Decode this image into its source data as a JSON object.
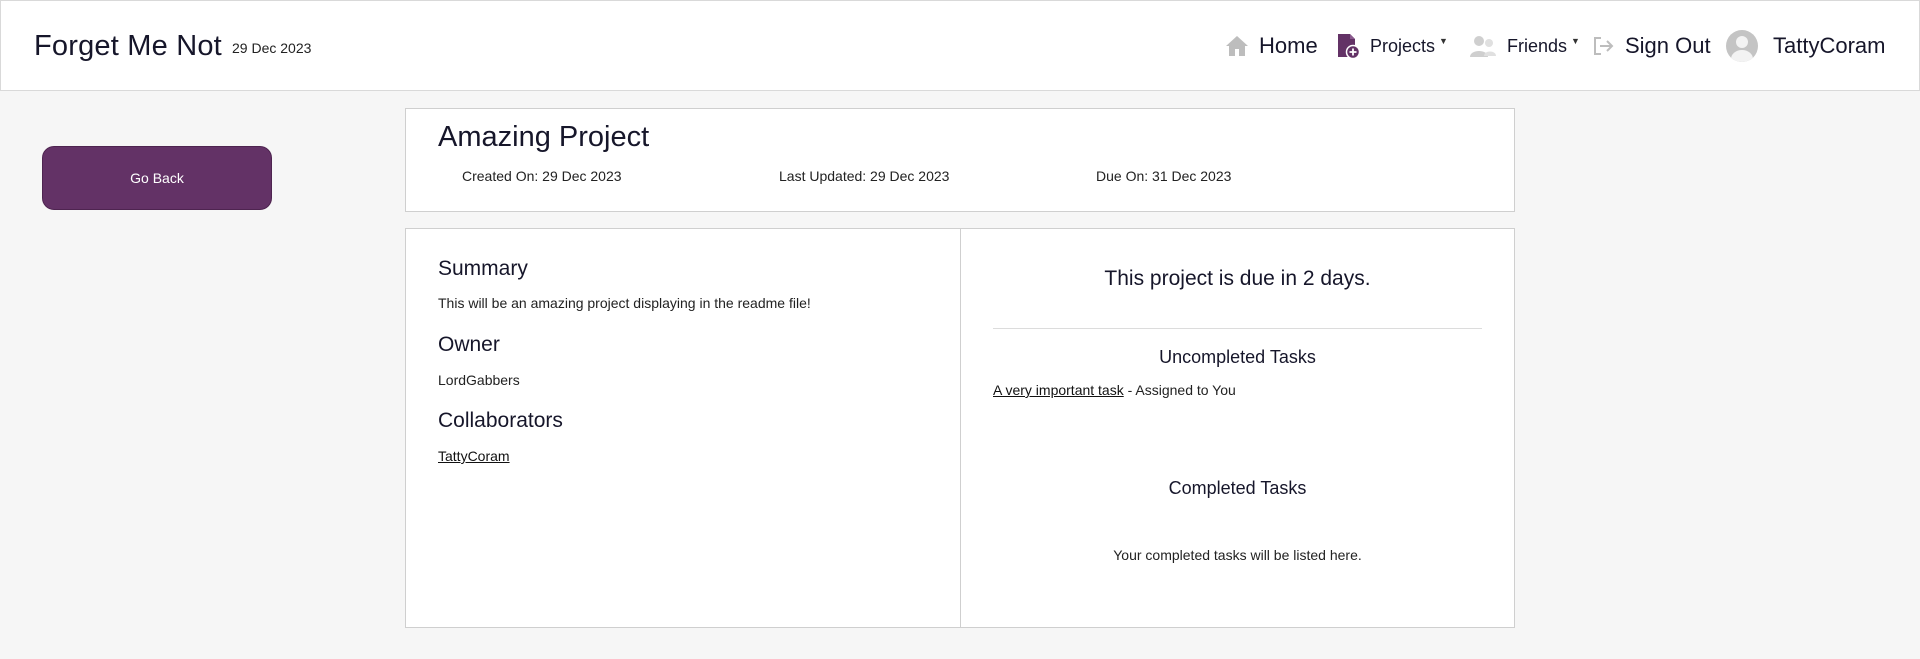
{
  "nav": {
    "brand": "Forget Me Not",
    "date": "29 Dec 2023",
    "home_label": "Home",
    "projects_label": "Projects",
    "friends_label": "Friends",
    "signout_label": "Sign Out",
    "username": "TattyCoram",
    "accent_color": "#633266"
  },
  "sidebar": {
    "go_back_label": "Go Back"
  },
  "project": {
    "title": "Amazing Project",
    "created_on": "Created On: 29 Dec 2023",
    "last_updated": "Last Updated: 29 Dec 2023",
    "due_on": "Due On: 31 Dec 2023"
  },
  "details": {
    "summary_heading": "Summary",
    "summary_text": "This will be an amazing project displaying in the readme file!",
    "owner_heading": "Owner",
    "owner_name": "LordGabbers",
    "collaborators_heading": "Collaborators",
    "collaborators": [
      "TattyCoram"
    ]
  },
  "tasks": {
    "due_message": "This project is due in 2 days.",
    "uncompleted_heading": "Uncompleted Tasks",
    "uncompleted": [
      {
        "name": "A very important task",
        "assigned": " - Assigned to You"
      }
    ],
    "completed_heading": "Completed Tasks",
    "completed_empty": "Your completed tasks will be listed here."
  }
}
